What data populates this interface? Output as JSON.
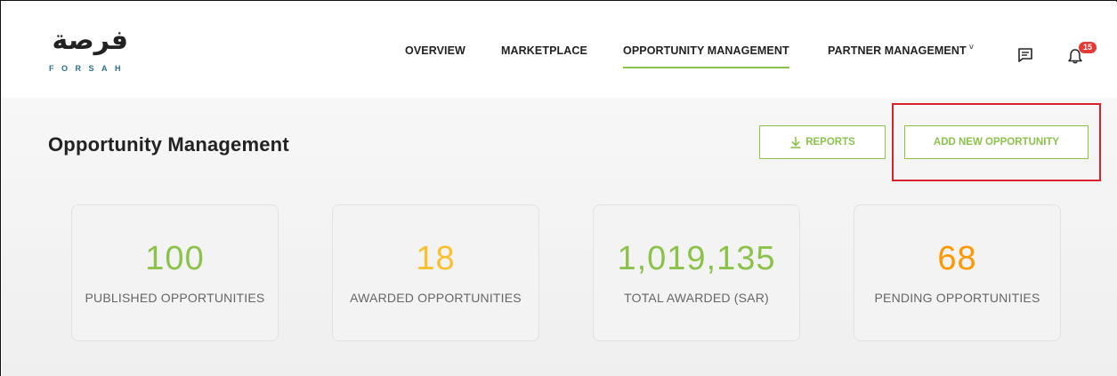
{
  "brand": {
    "arabic": "فرصة",
    "latin": "FORSAH"
  },
  "nav": {
    "items": [
      {
        "label": "OVERVIEW"
      },
      {
        "label": "MARKETPLACE"
      },
      {
        "label": "OPPORTUNITY MANAGEMENT",
        "active": true
      },
      {
        "label": "PARTNER MANAGEMENT",
        "dropdown": true
      }
    ],
    "notifications_count": "15"
  },
  "page": {
    "title": "Opportunity Management",
    "reports_label": "REPORTS",
    "add_label": "ADD NEW OPPORTUNITY"
  },
  "stats": [
    {
      "value": "100",
      "label": "PUBLISHED OPPORTUNITIES",
      "color": "#8bc34a"
    },
    {
      "value": "18",
      "label": "AWARDED OPPORTUNITIES",
      "color": "#fbc02d"
    },
    {
      "value": "1,019,135",
      "label": "TOTAL AWARDED (SAR)",
      "color": "#8bc34a"
    },
    {
      "value": "68",
      "label": "PENDING OPPORTUNITIES",
      "color": "#ff9800"
    }
  ],
  "colors": {
    "accent": "#8bc34a",
    "highlight": "#d8232a",
    "badge": "#e53935"
  }
}
